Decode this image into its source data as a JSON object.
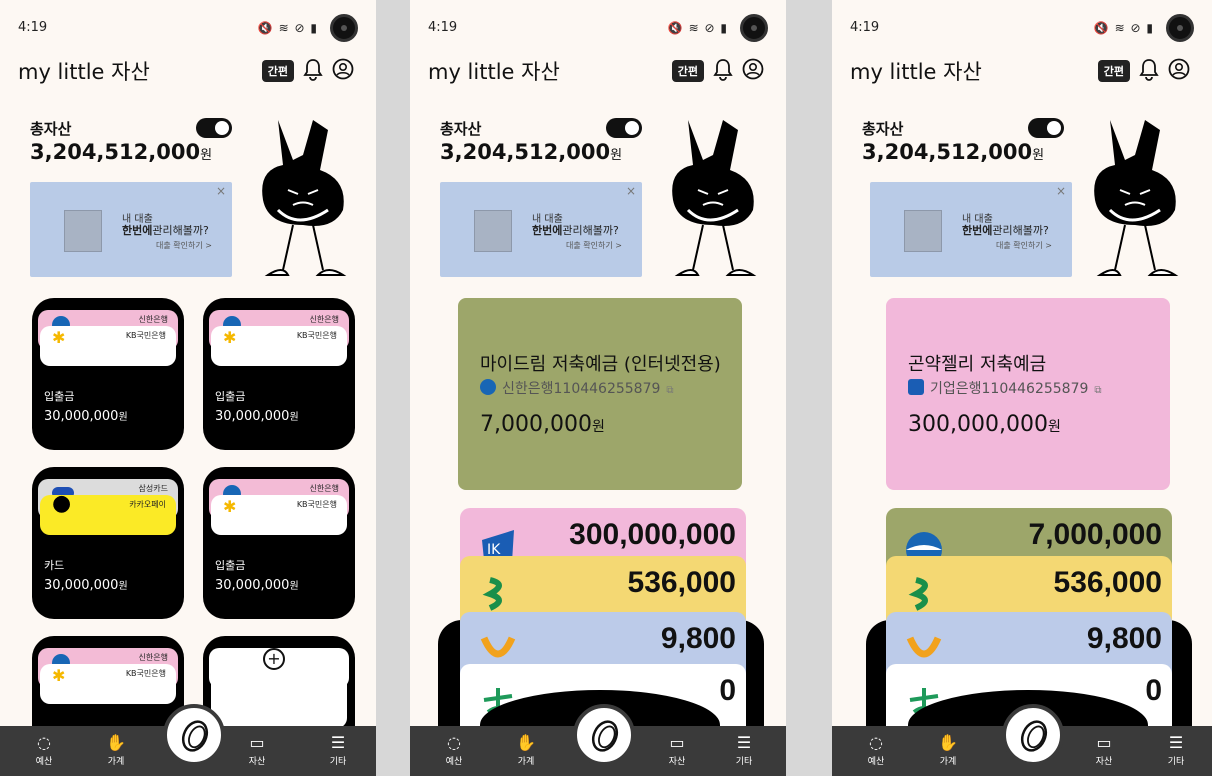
{
  "status": {
    "time": "4:19",
    "icons": "🔇 ≋ ⊘ ▮"
  },
  "app": {
    "name": "my little 자산",
    "easy_label": "간편"
  },
  "summary": {
    "label": "총자산",
    "value": "3,204,512,000",
    "unit": "원"
  },
  "banner": {
    "line1": "내 대출",
    "line2_bold": "한번에",
    "line2_rest": "관리해볼까?",
    "link": "대출 확인하기 >",
    "close": "×"
  },
  "tiles": [
    {
      "top_bank": "신한은행",
      "bottom_bank": "KB국민은행",
      "type": "입출금",
      "amount": "30,000,000",
      "unit": "원"
    },
    {
      "top_bank": "신한은행",
      "bottom_bank": "KB국민은행",
      "type": "입출금",
      "amount": "30,000,000",
      "unit": "원"
    },
    {
      "top_bank": "삼성카드",
      "bottom_bank": "카카오페이",
      "type": "카드",
      "amount": "30,000,000",
      "unit": "원",
      "top_logo": "Samsung"
    },
    {
      "top_bank": "신한은행",
      "bottom_bank": "KB국민은행",
      "type": "입출금",
      "amount": "30,000,000",
      "unit": "원"
    },
    {
      "top_bank": "신한은행",
      "bottom_bank": "KB국민은행"
    }
  ],
  "screen2": {
    "account": {
      "name": "마이드림 저축예금 (인터넷전용)",
      "bank": "신한은행110446255879",
      "balance": "7,000,000",
      "unit": "원",
      "color": "#9da66a"
    },
    "stack": [
      {
        "value": "300,000,000",
        "color": "#f2b8da",
        "icon": "ibk-icon"
      },
      {
        "value": "536,000",
        "color": "#f4d873",
        "icon": "sc-icon"
      },
      {
        "value": "9,800",
        "color": "#bccbe9",
        "icon": "saemaeul-icon"
      },
      {
        "value": "0",
        "color": "#ffffff",
        "icon": "nonghyup-icon"
      }
    ]
  },
  "screen3": {
    "account": {
      "name": "곤약젤리 저축예금",
      "bank": "기업은행110446255879",
      "balance": "300,000,000",
      "unit": "원",
      "color": "#f2b8da"
    },
    "stack": [
      {
        "value": "7,000,000",
        "color": "#9da66a",
        "icon": "shinhan-icon"
      },
      {
        "value": "536,000",
        "color": "#f4d873",
        "icon": "sc-icon"
      },
      {
        "value": "9,800",
        "color": "#bccbe9",
        "icon": "saemaeul-icon"
      },
      {
        "value": "0",
        "color": "#ffffff",
        "icon": "nonghyup-icon"
      }
    ]
  },
  "nav": {
    "budget": "예산",
    "household": "가계",
    "assets": "자산",
    "more": "기타"
  }
}
